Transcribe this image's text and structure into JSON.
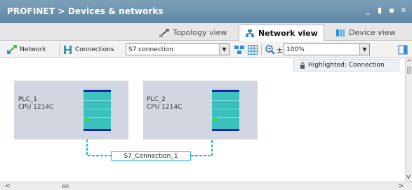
{
  "window": {
    "title": "PROFINET > Devices & networks",
    "controls": [
      "_",
      "▮",
      "▪",
      "✕"
    ]
  },
  "tabs": [
    {
      "label": "Topology view",
      "icon": "topology-icon",
      "active": false
    },
    {
      "label": "Network view",
      "icon": "network-icon",
      "active": true
    },
    {
      "label": "Device view",
      "icon": "device-icon",
      "active": false
    }
  ],
  "toolbar": {
    "network_label": "Network",
    "connections_label": "Connections",
    "connection_type": "S7 connection",
    "zoom": "100%"
  },
  "highlight": {
    "text": "Highlighted: Connection"
  },
  "devices": [
    {
      "name": "PLC_1",
      "type": "CPU 1214C"
    },
    {
      "name": "PLC_2",
      "type": "CPU 1214C"
    }
  ],
  "connection": {
    "label": "S7_Connection_1",
    "color": "#23b8d8"
  },
  "colors": {
    "title_bar": "#6f94b0",
    "device_bg": "#d2d6e0",
    "cpu_teal": "#3bbfbf",
    "cpu_bar": "#1e25a8"
  }
}
